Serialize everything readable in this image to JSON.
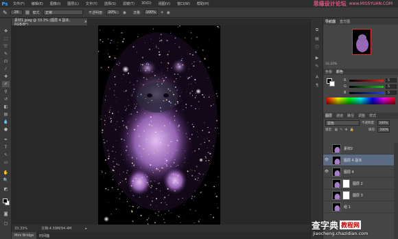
{
  "app": {
    "logo": "Ps"
  },
  "menubar": {
    "items": [
      "文件(F)",
      "编辑(E)",
      "图像(I)",
      "图层(L)",
      "文字(Y)",
      "选择(S)",
      "滤镜(T)",
      "3D(D)",
      "视图(V)",
      "窗口(W)",
      "帮助(H)"
    ],
    "window_controls": [
      "–",
      "▫",
      "✕"
    ]
  },
  "watermark_top": {
    "cn": "思缘设计论坛",
    "url": "www.MISSYUAN.COM"
  },
  "options_bar": {
    "brush_size": "28",
    "mode_label": "模式:",
    "mode_value": "正常",
    "opacity_label": "不透明度:",
    "opacity_value": "20%",
    "flow_label": "流量:",
    "flow_value": "100%"
  },
  "document_tab": {
    "title": "素材1.jpeg @ 33.3% (图层 4 副本, RGB/8*)",
    "close": "×"
  },
  "statusbar": {
    "zoom": "33.33%",
    "doc_info": "文档:4.39M/94.4M",
    "arrow": "▸"
  },
  "bottom_tabs": [
    "Mini Bridge",
    "时间轴"
  ],
  "navigator_panel": {
    "tabs": [
      "导航器",
      "直方图"
    ],
    "zoom": "33.33%"
  },
  "color_panel": {
    "tabs": [
      "色板",
      "颜色"
    ],
    "channels": [
      {
        "label": "R",
        "value": "5",
        "color": "#e02020"
      },
      {
        "label": "G",
        "value": "5",
        "color": "#20c020"
      },
      {
        "label": "B",
        "value": "5",
        "color": "#2040e0"
      }
    ]
  },
  "layers_panel": {
    "tabs": [
      "图层",
      "通道",
      "路径",
      "调整",
      "样式"
    ],
    "blend_mode": "滤色",
    "opacity_label": "不透明度:",
    "opacity_value": "100%",
    "lock_label": "锁定:",
    "fill_label": "填充:",
    "fill_value": "100%",
    "layers": [
      {
        "name": "素材2",
        "visible": false,
        "selected": false,
        "mask": false
      },
      {
        "name": "图层 4 副本",
        "visible": true,
        "selected": true,
        "mask": false
      },
      {
        "name": "图层 4",
        "visible": true,
        "selected": false,
        "mask": false
      },
      {
        "name": "图层 2",
        "visible": false,
        "selected": false,
        "mask": true
      },
      {
        "name": "图层 3",
        "visible": false,
        "selected": false,
        "mask": true
      },
      {
        "name": "组 1",
        "visible": false,
        "selected": false,
        "mask": false
      }
    ]
  },
  "watermark_bottom": {
    "cn": "查字典",
    "chip": "教程网",
    "url": "jiaocheng.chazidian.com"
  }
}
